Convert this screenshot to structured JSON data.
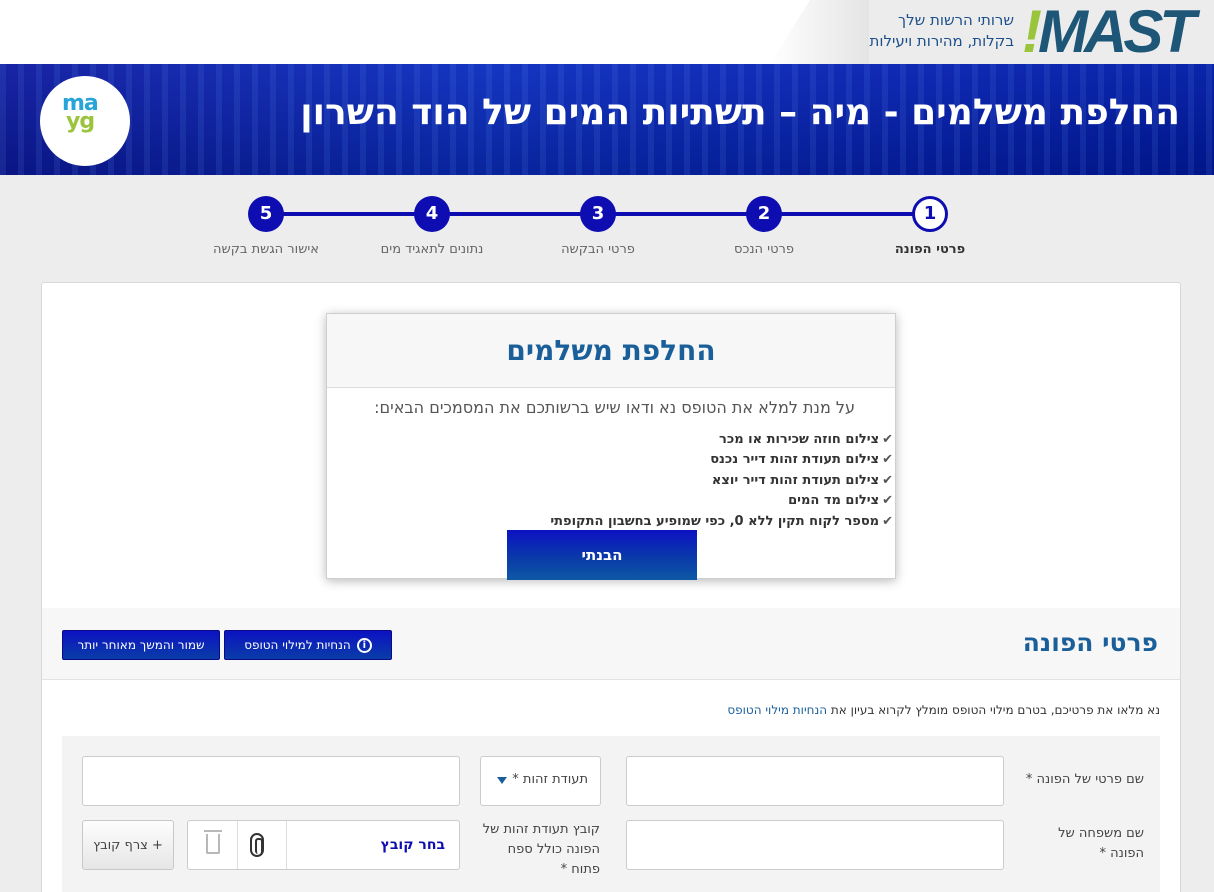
{
  "header": {
    "logo_text": "MAST",
    "logo_mark": "!",
    "tagline_line1": "שרותי הרשות שלך",
    "tagline_line2": "בקלות, מהירות ויעילות",
    "banner_title": "החלפת משלמים - מיה – תשתיות המים של הוד השרון",
    "partner_logo_line1": "ma",
    "partner_logo_line2": "yg"
  },
  "stepper": {
    "steps": [
      {
        "number": "1",
        "label": "פרטי הפונה",
        "active": true
      },
      {
        "number": "2",
        "label": "פרטי הנכס",
        "active": false
      },
      {
        "number": "3",
        "label": "פרטי הבקשה",
        "active": false
      },
      {
        "number": "4",
        "label": "נתונים לתאגיד מים",
        "active": false
      },
      {
        "number": "5",
        "label": "אישור הגשת בקשה",
        "active": false
      }
    ]
  },
  "modal": {
    "title": "החלפת משלמים",
    "intro": "על מנת למלא את הטופס נא ודאו שיש ברשותכם את המסמכים הבאים:",
    "items": [
      "צילום חוזה שכירות או מכר",
      "צילום תעודת זהות דייר נכנס",
      "צילום תעודת זהות דייר יוצא",
      "צילום מד המים",
      "מספר לקוח תקין ללא 0, כפי שמופיע בחשבון התקופתי"
    ],
    "ok_label": "הבנתי"
  },
  "section": {
    "title": "פרטי הפונה",
    "guide_button": "הנחיות למילוי הטופס",
    "save_button": "שמור והמשך מאוחר יותר",
    "note_text": "נא מלאו את פרטיכם, בטרם מילוי הטופס מומלץ לקרוא בעיון את ",
    "note_link": "הנחיות מילוי הטופס"
  },
  "form": {
    "first_name_label": "שם פרטי של הפונה *",
    "id_type_selected": "תעודת זהות *",
    "last_name_label": "שם משפחה של הפונה *",
    "id_file_label": "קובץ תעודת זהות של הפונה כולל ספח פתוח *",
    "choose_file": "בחר קובץ",
    "attach_file": "+ צרף קובץ"
  }
}
